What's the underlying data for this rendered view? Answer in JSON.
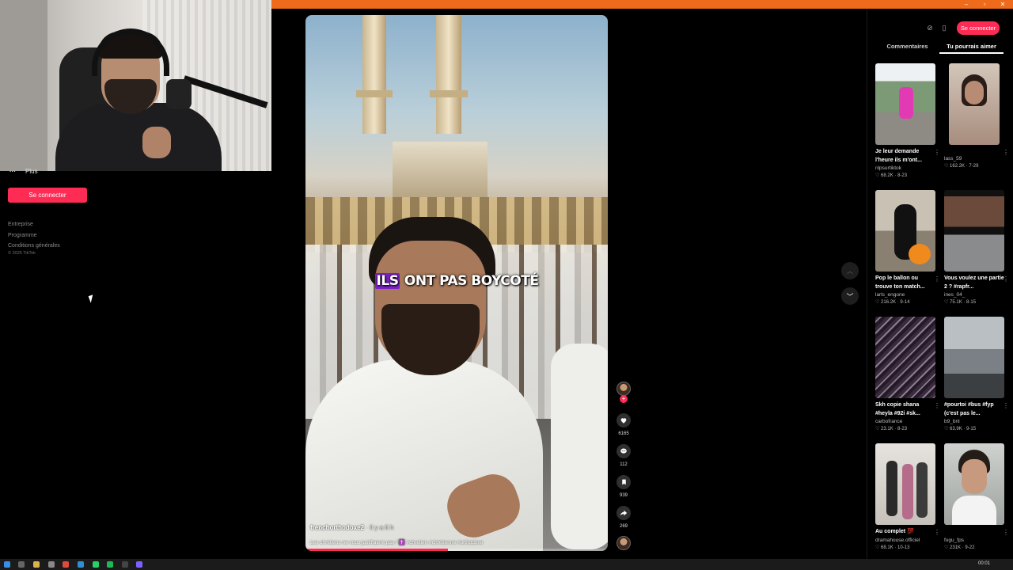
{
  "left_sidebar": {
    "more_label": "Plus",
    "login_button": "Se connecter",
    "footer_links": [
      "Entreprise",
      "Programme",
      "Conditions générales"
    ],
    "copyright": "© 2025 TikTok"
  },
  "video": {
    "caption_pre": "ILS",
    "caption_post": " ONT PAS BOYCOTÉ",
    "author": "frenchorthodoxe2",
    "time_ago": " · Il y a 6 h",
    "description": "Les chrétiens ne vous justifiaient pas ! ✝️ #chretien #chrétienne #orthodoxe",
    "progress": 0.47
  },
  "actions": {
    "likes": "6165",
    "comments": "112",
    "saves": "939",
    "shares": "269"
  },
  "right_panel": {
    "login_button": "Se connecter",
    "tabs": [
      "Commentaires",
      "Tu pourrais aimer"
    ],
    "active_tab": "Tu pourrais aimer",
    "cards": [
      {
        "title": "Je leur demande l'heure ils m'ont...",
        "user": "nlpsurtiktok",
        "meta": "♡ 68.2K · 8-23"
      },
      {
        "title": "",
        "user": "lass_59",
        "meta": "♡ 162.2K · 7-29"
      },
      {
        "title": "Pop le ballon ou trouve ton match...",
        "user": "larls_engone",
        "meta": "♡ 216.2K · 9-14"
      },
      {
        "title": "Vous voulez une partie 2 ? #rapfr...",
        "user": "ines_04_",
        "meta": "♡ 75.1K · 8-15"
      },
      {
        "title": "Skh copie shana #heyla #92i #sk...",
        "user": "carbofrance",
        "meta": "♡ 23.1K · 8-23"
      },
      {
        "title": "#pourtoi #bus #fyp (c'est pas le...",
        "user": "b9_bnl",
        "meta": "♡ 63.9K · 9-15"
      },
      {
        "title": "Au complet 💯",
        "user": "dramahouse.officiel",
        "meta": "♡ 68.1K · 10-13"
      },
      {
        "title": "",
        "user": "fugu_fps",
        "meta": "♡ 231K · 9-22"
      }
    ]
  },
  "taskbar": {
    "time": "00:01"
  },
  "colors": {
    "accent": "#fe2c55",
    "top_strip": "#ef6a1b"
  }
}
